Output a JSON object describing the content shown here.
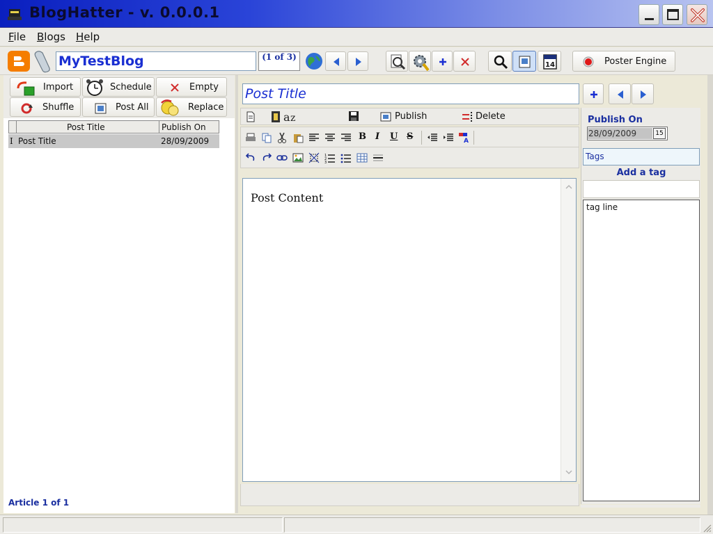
{
  "window": {
    "title": "BlogHatter - v. 0.0.0.1"
  },
  "menu": [
    {
      "label": "File",
      "u": "F",
      "rest": "ile"
    },
    {
      "label": "Blogs",
      "u": "B",
      "rest": "logs"
    },
    {
      "label": "Help",
      "u": "H",
      "rest": "elp"
    }
  ],
  "toolbar": {
    "blog_name": "MyTestBlog",
    "blog_position": "(1 of 3)",
    "poster_engine_label": "Poster Engine"
  },
  "left": {
    "buttons": {
      "import": "Import",
      "schedule": "Schedule",
      "empty": "Empty",
      "shuffle": "Shuffle",
      "post_all": "Post All",
      "replace": "Replace"
    },
    "columns": [
      "Post Title",
      "Publish On"
    ],
    "rows": [
      {
        "marker": "I",
        "title": "Post Title",
        "publish_on": "28/09/2009"
      }
    ],
    "article_count": "Article 1 of 1"
  },
  "editor": {
    "post_title": "Post Title",
    "publish_label": "Publish",
    "delete_label": "Delete",
    "content": "Post Content"
  },
  "right": {
    "publish_on_label": "Publish On",
    "publish_date": "28/09/2009",
    "calendar_glyph": "15",
    "tags_placeholder": "Tags",
    "add_tag_label": "Add a tag",
    "tags": [
      "tag line"
    ]
  },
  "colors": {
    "accent_blue": "#1a2fd2",
    "label_blue": "#1a2fa0",
    "title_gradient_start": "#0a1fbf"
  }
}
